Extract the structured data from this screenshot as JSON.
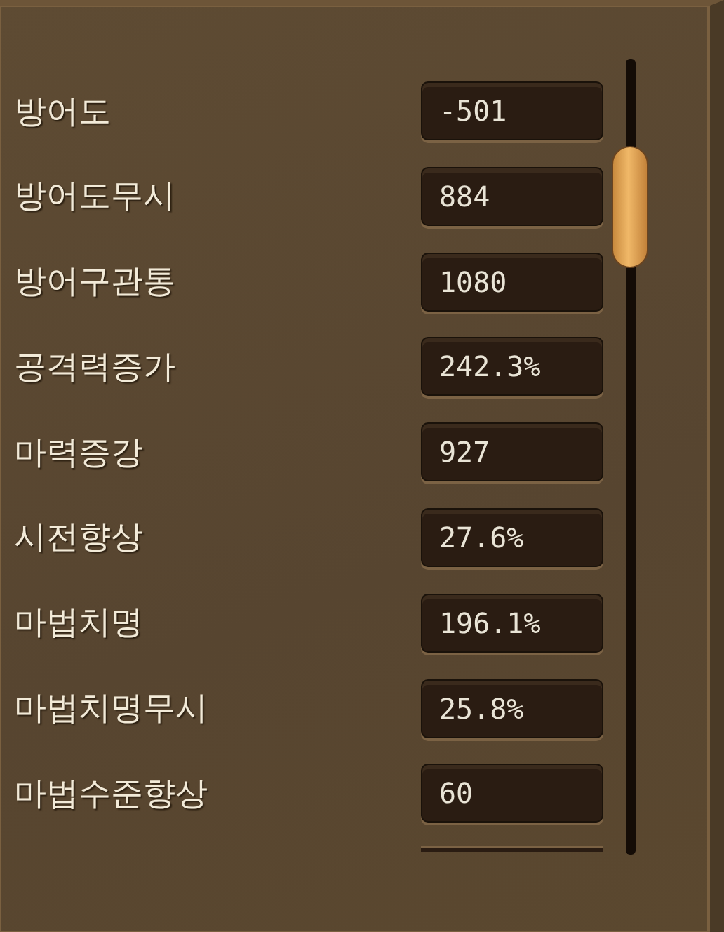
{
  "stats": [
    {
      "label": "방어도",
      "value": "-501"
    },
    {
      "label": "방어도무시",
      "value": "884"
    },
    {
      "label": "방어구관통",
      "value": "1080"
    },
    {
      "label": "공격력증가",
      "value": "242.3%"
    },
    {
      "label": "마력증강",
      "value": "927"
    },
    {
      "label": "시전향상",
      "value": "27.6%"
    },
    {
      "label": "마법치명",
      "value": "196.1%"
    },
    {
      "label": "마법치명무시",
      "value": "25.8%"
    },
    {
      "label": "마법수준향상",
      "value": "60"
    }
  ]
}
